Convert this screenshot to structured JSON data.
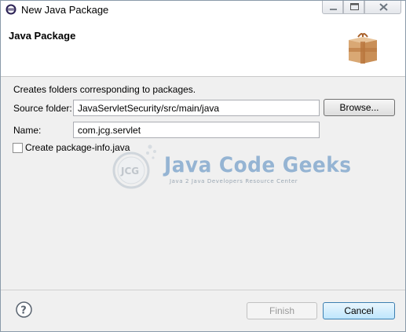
{
  "window": {
    "title": "New Java Package",
    "icon": "eclipse-icon"
  },
  "banner": {
    "title": "Java Package",
    "icon": "package-icon"
  },
  "form": {
    "description": "Creates folders corresponding to packages.",
    "source_folder_label": "Source folder:",
    "source_folder_value": "JavaServletSecurity/src/main/java",
    "browse_label": "Browse...",
    "name_label": "Name:",
    "name_value": "com.jcg.servlet",
    "create_package_info_label": "Create package-info.java",
    "create_package_info_checked": false
  },
  "watermark": {
    "logo_text": "JCG",
    "title": "Java Code Geeks",
    "subtitle": "Java 2 Java Developers Resource Center"
  },
  "footer": {
    "help_icon": "help-icon",
    "finish_label": "Finish",
    "finish_enabled": false,
    "cancel_label": "Cancel"
  }
}
